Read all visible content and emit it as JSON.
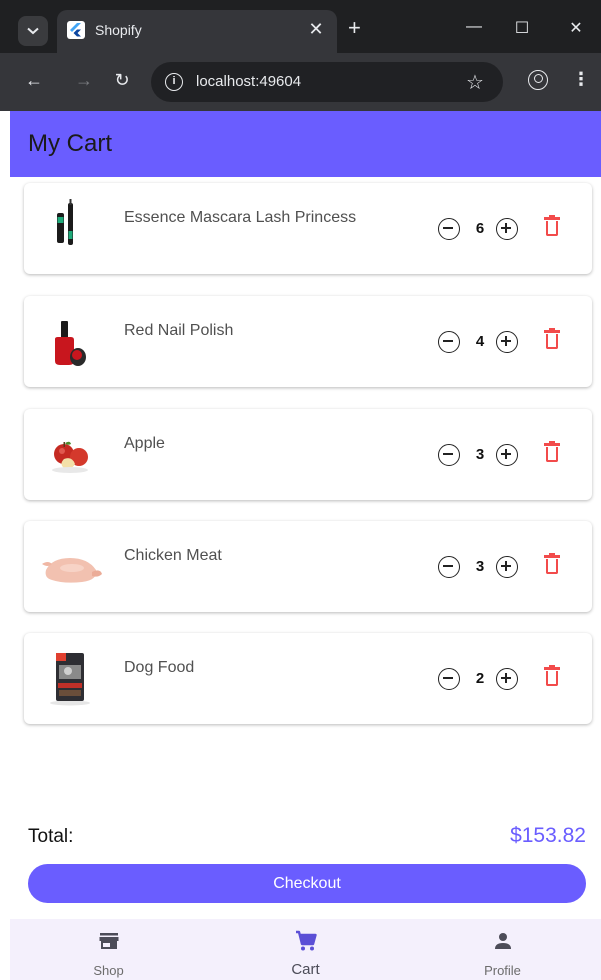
{
  "browser": {
    "tab_title": "Shopify",
    "url": "localhost:49604"
  },
  "app": {
    "title": "My Cart",
    "accent_color": "#6a5dff",
    "delete_color": "#f24b4b"
  },
  "cart": {
    "items": [
      {
        "name": "Essence Mascara Lash Princess",
        "quantity": "6",
        "image": "mascara"
      },
      {
        "name": "Red Nail Polish",
        "quantity": "4",
        "image": "nail-polish"
      },
      {
        "name": "Apple",
        "quantity": "3",
        "image": "apple"
      },
      {
        "name": "Chicken Meat",
        "quantity": "3",
        "image": "chicken"
      },
      {
        "name": "Dog Food",
        "quantity": "2",
        "image": "dog-food"
      }
    ],
    "total_label": "Total:",
    "total_value": "$153.82",
    "checkout_label": "Checkout"
  },
  "bottom_nav": {
    "items": [
      {
        "label": "Shop",
        "icon": "store-icon"
      },
      {
        "label": "Cart",
        "icon": "cart-icon",
        "active": true
      },
      {
        "label": "Profile",
        "icon": "person-icon"
      }
    ]
  }
}
